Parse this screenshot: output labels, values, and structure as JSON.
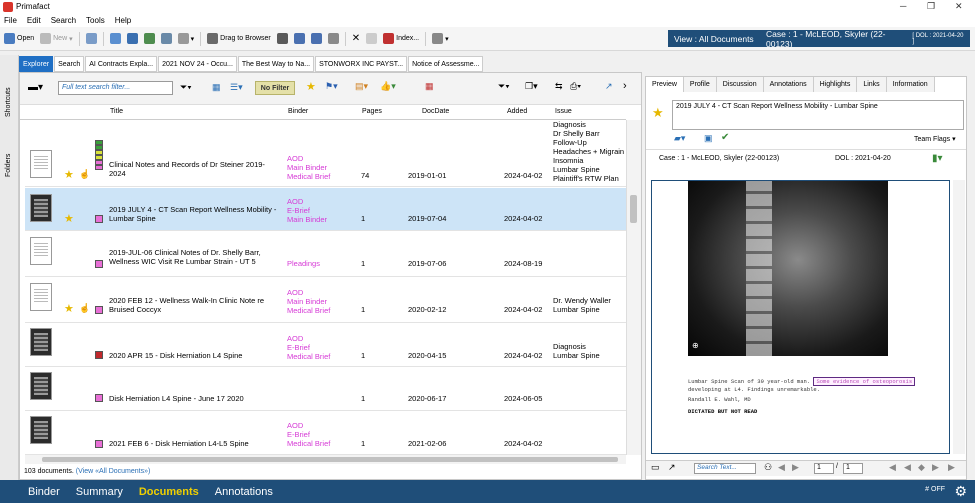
{
  "app": {
    "title": "Primafact"
  },
  "menu": [
    "File",
    "Edit",
    "Search",
    "Tools",
    "Help"
  ],
  "toolbar": {
    "open": "Open",
    "new": "New",
    "drag": "Drag to Browser",
    "index": "Index..."
  },
  "view_button": "View : All Documents",
  "case": {
    "label": "Case : 1 - McLEOD, Skyler (22-00123)",
    "dol": "[ DOL : 2021-04-20 ]"
  },
  "sidebar": {
    "shortcuts": "Shortcuts",
    "folders": "Folders"
  },
  "tabs": [
    "Explorer",
    "Search",
    "AI Contracts Expla...",
    "2021 NOV 24 - Occu...",
    "The Best Way to Na...",
    "STONWORX INC PAYST...",
    "Notice of Assessme..."
  ],
  "grid": {
    "search_placeholder": "Full text search filter...",
    "nofilter": "No Filter",
    "columns": {
      "title": "Title",
      "binder": "Binder",
      "pages": "Pages",
      "docdate": "DocDate",
      "added": "Added",
      "issue": "Issue"
    }
  },
  "rows": [
    {
      "title": "Clinical Notes and Records of Dr Steiner 2019-2024",
      "binder": [
        "AOD",
        "Main Binder",
        "Medical Brief"
      ],
      "pages": "74",
      "docdate": "2019-01-01",
      "added": "2024-04-02",
      "issue": [
        "Diagnosis",
        "Dr Shelly Barr",
        "Follow-Up",
        "Headaches + Migrain",
        "Insomnia",
        "Lumbar Spine",
        "Plaintiff's RTW Plan"
      ],
      "color": "#e86fd6"
    },
    {
      "title": "2019 JULY 4 - CT Scan Report Wellness Mobility - Lumbar Spine",
      "binder": [
        "AOD",
        "E-Brief",
        "Main Binder"
      ],
      "pages": "1",
      "docdate": "2019-07-04",
      "added": "2024-04-02",
      "issue": [],
      "color": "#e86fd6"
    },
    {
      "title": "2019-JUL-06 Clinical Notes of Dr. Shelly Barr, Wellness WIC Visit Re Lumbar Strain - UT 5",
      "binder": [
        "Pleadings"
      ],
      "pages": "1",
      "docdate": "2019-07-06",
      "added": "2024-08-19",
      "issue": [],
      "color": "#e86fd6"
    },
    {
      "title": "2020 FEB 12 - Wellness Walk-In Clinic Note re Bruised Coccyx",
      "binder": [
        "AOD",
        "Main Binder",
        "Medical Brief"
      ],
      "pages": "1",
      "docdate": "2020-02-12",
      "added": "2024-04-02",
      "issue": [
        "Dr. Wendy Waller",
        "Lumbar Spine"
      ],
      "color": "#e86fd6"
    },
    {
      "title": "2020 APR 15 - Disk Herniation L4 Spine",
      "binder": [
        "AOD",
        "E-Brief",
        "Medical Brief"
      ],
      "pages": "1",
      "docdate": "2020-04-15",
      "added": "2024-04-02",
      "issue": [
        "Diagnosis",
        "Lumbar Spine"
      ],
      "color": "#c0282c"
    },
    {
      "title": "Disk Herniation L4  Spine - June 17 2020",
      "binder": [],
      "pages": "1",
      "docdate": "2020-06-17",
      "added": "2024-06-05",
      "issue": [],
      "color": "#e86fd6"
    },
    {
      "title": "2021 FEB 6 - Disk Herniation L4-L5 Spine",
      "binder": [
        "AOD",
        "E-Brief",
        "Medical Brief"
      ],
      "pages": "1",
      "docdate": "2021-02-06",
      "added": "2024-04-02",
      "issue": [],
      "color": "#e86fd6"
    }
  ],
  "status": {
    "count": "103 documents.",
    "view": "(View «All Documents»)"
  },
  "right": {
    "tabs": [
      "Preview",
      "Profile",
      "Discussion",
      "Annotations",
      "Highlights",
      "Links",
      "Information"
    ],
    "doc_title": "2019 JULY 4 - CT Scan Report Wellness Mobility - Lumbar Spine",
    "team_flags": "Team Flags",
    "case_line": "Case : 1 - McLEOD, Skyler (22-00123)",
    "dol_line": "DOL : 2021-04-20",
    "report_line1": "Lumbar Spine Scan of 39 year-old man.",
    "report_highlight": "Some evidence of osteoporosis",
    "report_line2": "developing at L4. Findings unremarkable.",
    "report_sig": "Randall E. Wahl, MD",
    "report_dictated": "DICTATED BUT NOT READ",
    "search_text": "Search Text...",
    "page_current": "1",
    "page_total": "1"
  },
  "footer": {
    "items": [
      "Binder",
      "Summary",
      "Documents",
      "Annotations"
    ],
    "active": "Documents",
    "off": "# OFF"
  }
}
